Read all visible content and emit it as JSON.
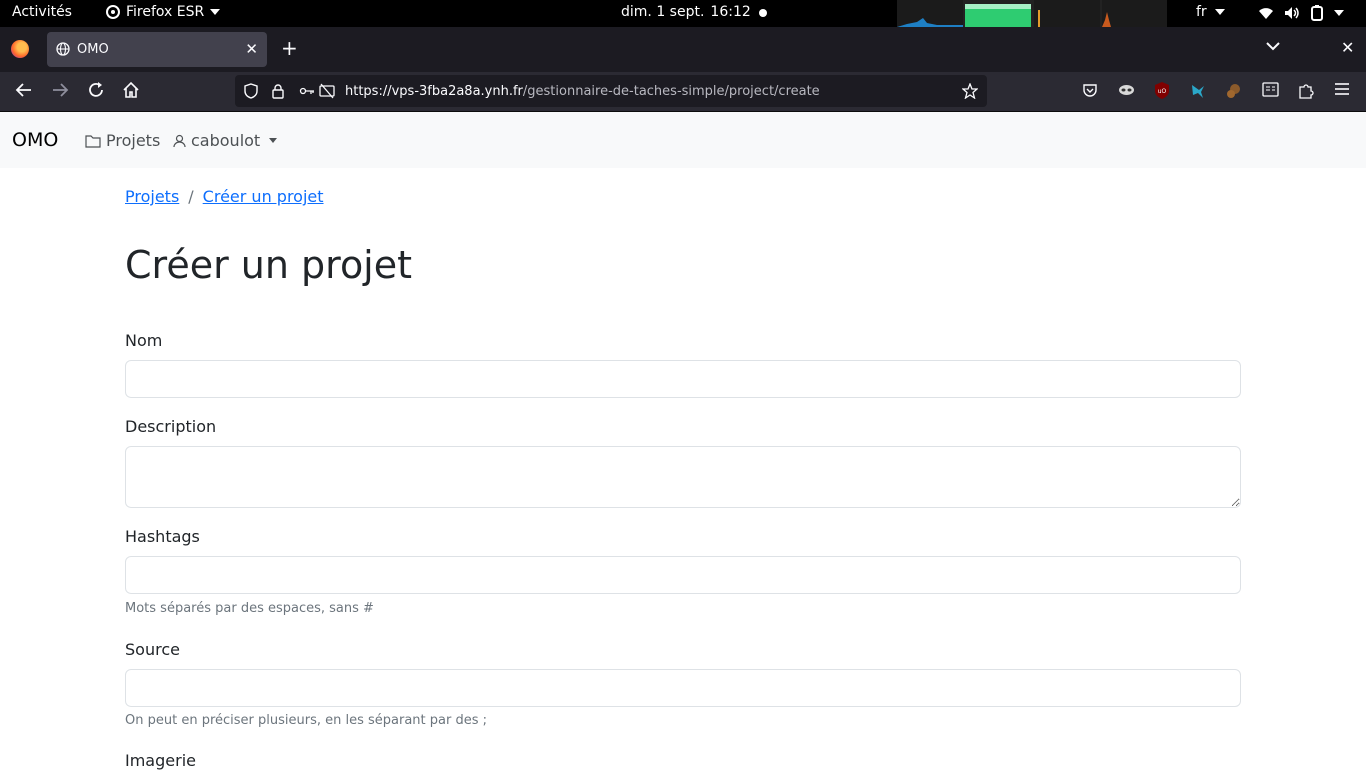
{
  "system_bar": {
    "activities": "Activités",
    "app_name": "Firefox ESR",
    "date": "dim. 1 sept.",
    "time": "16:12",
    "language": "fr"
  },
  "browser": {
    "tab_title": "OMO",
    "url_host": "https://vps-3fba2a8a.ynh.fr",
    "url_path": "/gestionnaire-de-taches-simple/project/create"
  },
  "app": {
    "brand": "OMO",
    "nav_projects": "Projets",
    "nav_user": "caboulot"
  },
  "breadcrumb": {
    "items": [
      "Projets",
      "Créer un projet"
    ],
    "separator": "/"
  },
  "form": {
    "title": "Créer un projet",
    "name_label": "Nom",
    "description_label": "Description",
    "hashtags_label": "Hashtags",
    "hashtags_help": "Mots séparés par des espaces, sans #",
    "source_label": "Source",
    "source_help": "On peut en préciser plusieurs, en les séparant par des ;",
    "imagery_label": "Imagerie"
  },
  "colors": {
    "link": "#0d6efd",
    "navbar_bg": "#f8f9fa",
    "browser_chrome": "#2b2a33"
  }
}
